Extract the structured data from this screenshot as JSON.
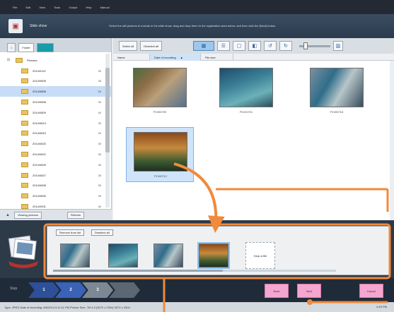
{
  "menu": {
    "items": [
      "File",
      "Edit",
      "View",
      "Tools",
      "Output",
      "Help",
      "Manual"
    ]
  },
  "header": {
    "mode_title": "Slide show",
    "instructions": "Select the still pictures to include in the slide show, drag and drop them to the registration area below, and then click the [Next] button."
  },
  "left_panel": {
    "tabs": [
      "",
      "Folder",
      ""
    ],
    "tree": [
      {
        "label": "Pictures",
        "count": "",
        "root": true
      },
      {
        "label": "2014/0110",
        "count": "30"
      },
      {
        "label": "2014/0805",
        "count": "36"
      },
      {
        "label": "2014/0806",
        "count": "55",
        "selected": true
      },
      {
        "label": "2014/0808",
        "count": "30"
      },
      {
        "label": "2014/0809",
        "count": "40"
      },
      {
        "label": "2014/0813",
        "count": "30"
      },
      {
        "label": "2014/0815",
        "count": "40"
      },
      {
        "label": "2014/0820",
        "count": "30"
      },
      {
        "label": "2014/0822",
        "count": "30"
      },
      {
        "label": "2014/0825",
        "count": "30"
      },
      {
        "label": "2014/0827",
        "count": "30"
      },
      {
        "label": "2014/0828",
        "count": "30"
      },
      {
        "label": "2014/0830",
        "count": "30"
      },
      {
        "label": "2014/0901",
        "count": "30"
      }
    ],
    "bottom_label": "Viewing pictures",
    "bottom_btn": "Refresh"
  },
  "toolbar": {
    "select_all": "Select all",
    "deselect_all": "Deselect all"
  },
  "sort": {
    "name": "Name",
    "date": "Date of recording",
    "file_size": "File size"
  },
  "thumbnails": [
    {
      "name": "P1000709"
    },
    {
      "name": "P1010701"
    },
    {
      "name": "P1000718"
    },
    {
      "name": "P1000712"
    }
  ],
  "strip": {
    "remove_btn": "Remove from list",
    "deselect_btn": "Deselect all",
    "drop_label": "Drop a file"
  },
  "steps": {
    "label": "Step",
    "items": [
      "1",
      "2",
      "3",
      ""
    ]
  },
  "buttons": {
    "back": "Back",
    "next": "Next",
    "cancel": "Cancel"
  },
  "status": {
    "text": "Type: JPEG  Date of recording: 8/6/2014 5:11:11 PM  Picture Size: 7M 4:3 (3072 x 2304)  3072 x 2304",
    "right": "4:40 PM"
  }
}
